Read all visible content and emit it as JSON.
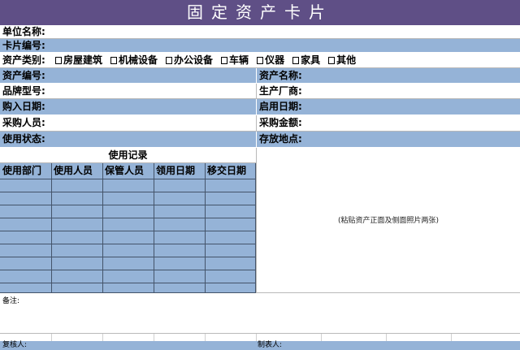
{
  "title": "固定资产卡片",
  "unit_label": "单位名称:",
  "card_no_label": "卡片编号:",
  "category": {
    "label": "资产类别:",
    "options": [
      "房屋建筑",
      "机械设备",
      "办公设备",
      "车辆",
      "仪器",
      "家具",
      "其他"
    ]
  },
  "fields": {
    "asset_no": "资产编号:",
    "asset_name": "资产名称:",
    "brand_model": "品牌型号:",
    "manufacturer": "生产厂商:",
    "purchase_date": "购入日期:",
    "start_date": "启用日期:",
    "buyer": "采购人员:",
    "amount": "采购金额:",
    "status": "使用状态:",
    "location": "存放地点:"
  },
  "usage_record": {
    "title": "使用记录",
    "columns": [
      "使用部门",
      "使用人员",
      "保管人员",
      "领用日期",
      "移交日期"
    ]
  },
  "photo_hint": "(粘贴资产正面及侧面照片两张)",
  "remarks_label": "备注:",
  "footer": {
    "reviewer": "复核人:",
    "maker": "制表人:"
  }
}
